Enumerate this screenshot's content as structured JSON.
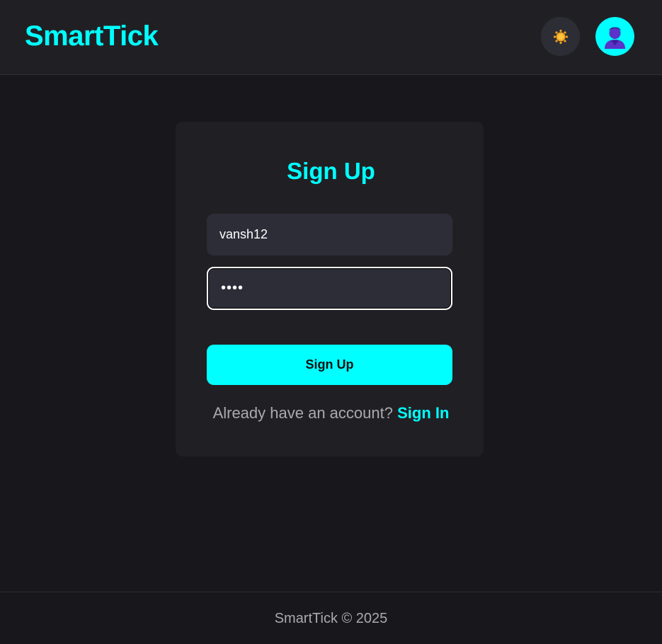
{
  "colors": {
    "accent": "#00ffff",
    "background": "#18181c",
    "surface": "#202024",
    "input": "#2d2d38",
    "muted_text": "#a9a9b0"
  },
  "header": {
    "brand": "SmartTick",
    "theme_toggle_icon": "sun-icon",
    "profile_icon": "user-avatar-icon"
  },
  "signup": {
    "title": "Sign Up",
    "username_value": "vansh12",
    "password_value": "abcd",
    "submit_label": "Sign Up",
    "switch_prompt": "Already have an account?",
    "switch_link": "Sign In"
  },
  "footer": {
    "text": "SmartTick © 2025"
  }
}
